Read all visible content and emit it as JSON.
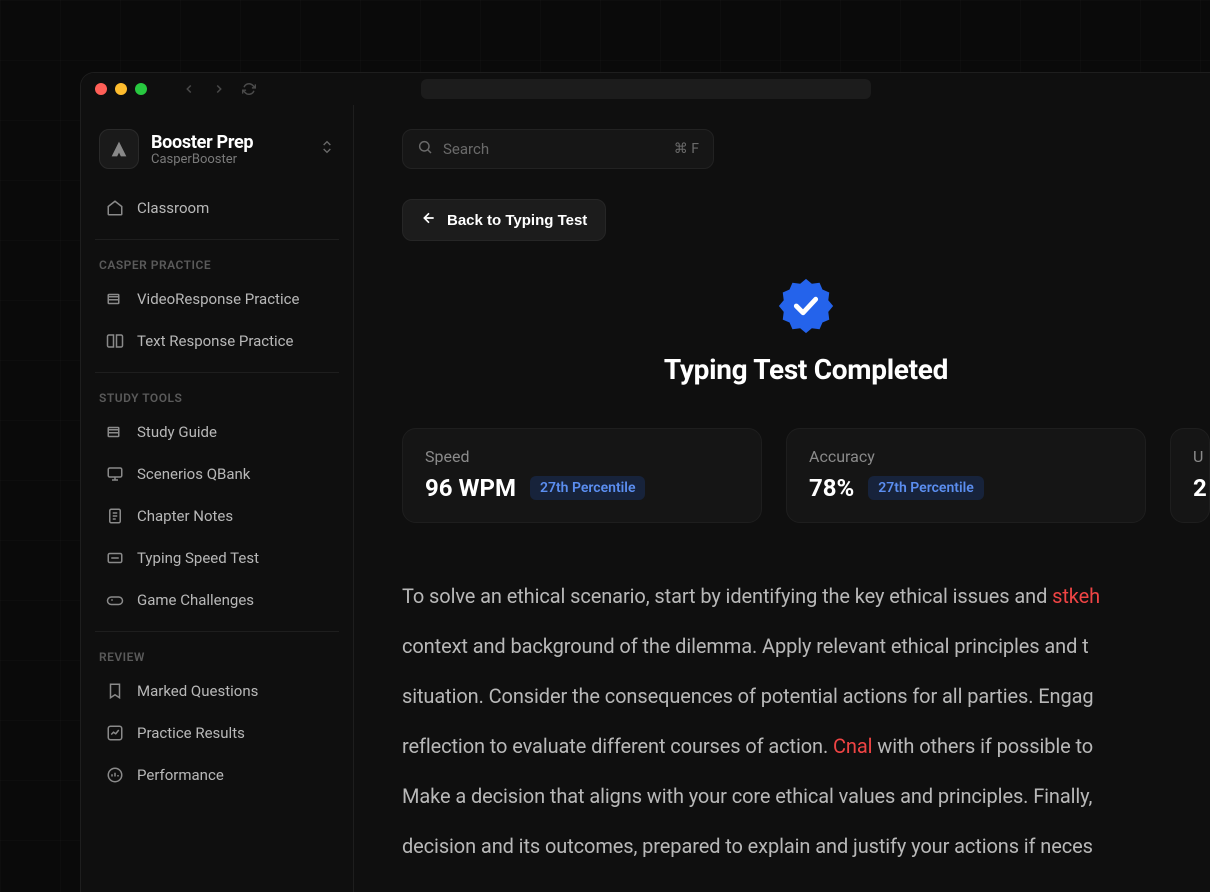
{
  "brand": {
    "title": "Booster Prep",
    "subtitle": "CasperBooster"
  },
  "sidebar": {
    "top_item": "Classroom",
    "sections": [
      {
        "header": "CASPER PRACTICE",
        "items": [
          "VideoResponse Practice",
          "Text Response Practice"
        ]
      },
      {
        "header": "STUDY TOOLS",
        "items": [
          "Study Guide",
          "Scenerios QBank",
          "Chapter Notes",
          "Typing Speed Test",
          "Game Challenges"
        ]
      },
      {
        "header": "REVIEW",
        "items": [
          "Marked Questions",
          "Practice Results",
          "Performance"
        ]
      }
    ]
  },
  "search": {
    "placeholder": "Search",
    "shortcut": "⌘ F"
  },
  "back_button": "Back to Typing Test",
  "hero_title": "Typing Test Completed",
  "stats": [
    {
      "label": "Speed",
      "value": "96 WPM",
      "percentile": "27th Percentile"
    },
    {
      "label": "Accuracy",
      "value": "78%",
      "percentile": "27th Percentile"
    },
    {
      "label": "U",
      "value": "2"
    }
  ],
  "passage": {
    "p1a": "To solve an ethical scenario, start by identifying the key ethical issues and ",
    "err1": "stkeh",
    "p2": "context and background of the dilemma. Apply relevant ethical principles and t",
    "p3": "situation. Consider the consequences of potential actions for all parties. Engag",
    "p4a": "reflection to evaluate different courses of action. ",
    "err2": "Cnal",
    "p4b": " with others if possible to",
    "p5": "Make a decision that aligns with your core ethical values and principles. Finally,",
    "p6": "decision and its outcomes, prepared to explain and justify your actions if neces"
  }
}
